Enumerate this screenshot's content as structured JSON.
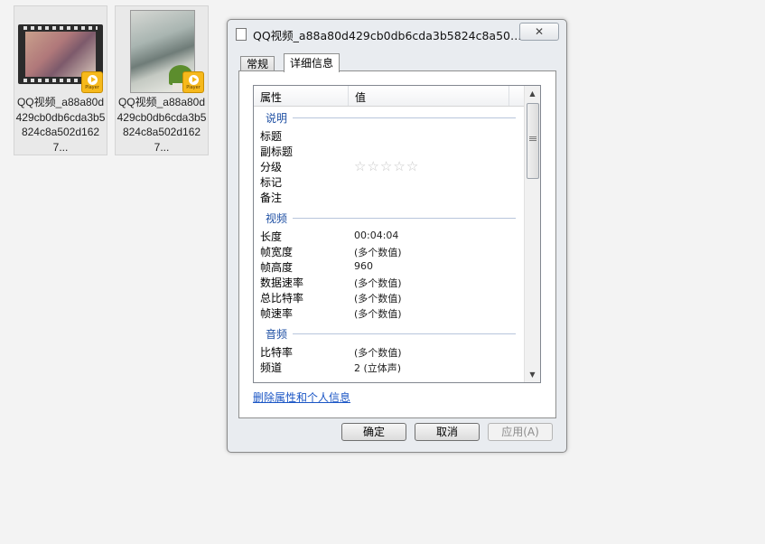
{
  "desktop": {
    "files": [
      {
        "name": "QQ视频_a88a80d429cb0db6cda3b5824c8a502d1627...",
        "badge": "Player"
      },
      {
        "name": "QQ视频_a88a80d429cb0db6cda3b5824c8a502d1627...",
        "badge": "Player"
      }
    ]
  },
  "dialog": {
    "title": "QQ视频_a88a80d429cb0db6cda3b5824c8a502d1...",
    "close_label": "✕",
    "tabs": [
      {
        "label": "常规",
        "selected": false
      },
      {
        "label": "详细信息",
        "selected": true
      }
    ],
    "columns": {
      "property": "属性",
      "value": "值"
    },
    "sections": {
      "description": {
        "label": "说明",
        "rows": [
          {
            "key": "标题",
            "value": ""
          },
          {
            "key": "副标题",
            "value": ""
          },
          {
            "key": "分级",
            "value": "",
            "stars": 5,
            "filled": 0
          },
          {
            "key": "标记",
            "value": ""
          },
          {
            "key": "备注",
            "value": ""
          }
        ]
      },
      "video": {
        "label": "视频",
        "rows": [
          {
            "key": "长度",
            "value": "00:04:04"
          },
          {
            "key": "帧宽度",
            "value": "(多个数值)"
          },
          {
            "key": "帧高度",
            "value": "960"
          },
          {
            "key": "数据速率",
            "value": "(多个数值)"
          },
          {
            "key": "总比特率",
            "value": "(多个数值)"
          },
          {
            "key": "帧速率",
            "value": "(多个数值)"
          }
        ]
      },
      "audio": {
        "label": "音频",
        "rows": [
          {
            "key": "比特率",
            "value": "(多个数值)"
          },
          {
            "key": "频道",
            "value": "2 (立体声)"
          }
        ]
      }
    },
    "remove_link": "删除属性和个人信息",
    "buttons": {
      "ok": "确定",
      "cancel": "取消",
      "apply": "应用(A)"
    }
  },
  "colors": {
    "link": "#1b56c5",
    "section_label": "#1e4fa3",
    "dialog_bg": "#e9ecf0"
  }
}
